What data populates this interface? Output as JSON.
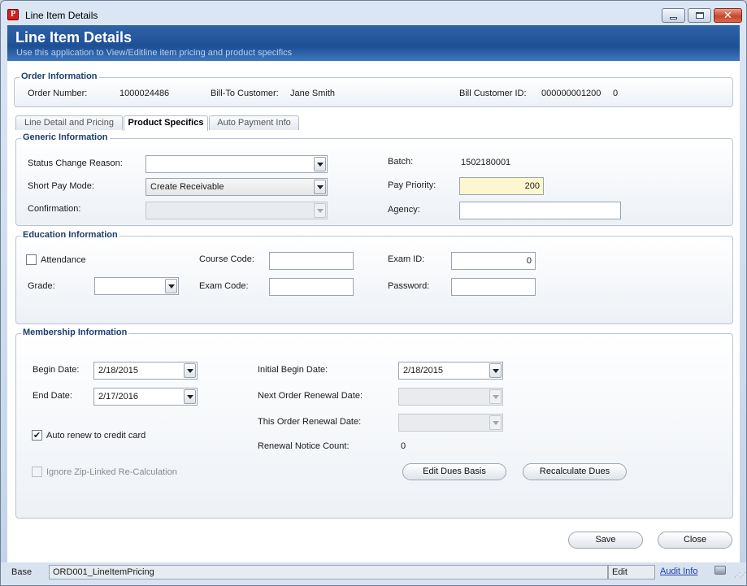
{
  "window": {
    "title": "Line Item Details",
    "app_icon_glyph": "P",
    "controls": {
      "minimize": "minimize-icon",
      "maximize": "maximize-icon",
      "close": "close-icon"
    }
  },
  "banner": {
    "title": "Line Item Details",
    "subtitle": "Use this application to View/Editline item pricing and product specifics"
  },
  "order_info": {
    "title": "Order Information",
    "order_number_label": "Order Number:",
    "order_number": "1000024486",
    "bill_to_label": "Bill-To Customer:",
    "bill_to": "Jane Smith",
    "bill_id_label": "Bill Customer ID:",
    "bill_id": "000000001200",
    "bill_id_suffix": "0"
  },
  "tabs": [
    {
      "label": "Line Detail and Pricing",
      "active": false
    },
    {
      "label": "Product Specifics",
      "active": true
    },
    {
      "label": "Auto Payment Info",
      "active": false
    }
  ],
  "generic": {
    "title": "Generic Information",
    "status_change_reason_label": "Status Change Reason:",
    "status_change_reason": "",
    "short_pay_mode_label": "Short Pay Mode:",
    "short_pay_mode": "Create Receivable",
    "confirmation_label": "Confirmation:",
    "confirmation": "",
    "batch_label": "Batch:",
    "batch": "1502180001",
    "pay_priority_label": "Pay Priority:",
    "pay_priority": "200",
    "agency_label": "Agency:",
    "agency": ""
  },
  "education": {
    "title": "Education Information",
    "attendance_label": "Attendance",
    "attendance_checked": false,
    "grade_label": "Grade:",
    "grade": "",
    "course_code_label": "Course Code:",
    "course_code": "",
    "exam_code_label": "Exam Code:",
    "exam_code": "",
    "exam_id_label": "Exam ID:",
    "exam_id": "0",
    "password_label": "Password:",
    "password": ""
  },
  "membership": {
    "title": "Membership Information",
    "begin_date_label": "Begin Date:",
    "begin_date": "2/18/2015",
    "end_date_label": "End Date:",
    "end_date": "2/17/2016",
    "auto_renew_label": "Auto renew to credit card",
    "auto_renew_checked": true,
    "ignore_zip_label": "Ignore Zip-Linked Re-Calculation",
    "ignore_zip_checked": false,
    "initial_begin_label": "Initial Begin Date:",
    "initial_begin": "2/18/2015",
    "next_renewal_label": "Next Order Renewal Date:",
    "next_renewal": "",
    "this_renewal_label": "This Order Renewal Date:",
    "this_renewal": "",
    "renewal_count_label": "Renewal Notice Count:",
    "renewal_count": "0",
    "edit_dues_label": "Edit Dues Basis",
    "recalc_dues_label": "Recalculate Dues"
  },
  "actions": {
    "save": "Save",
    "close": "Close"
  },
  "statusbar": {
    "base": "Base",
    "form_name": "ORD001_LineItemPricing",
    "mode": "Edit",
    "audit_link": "Audit Info"
  }
}
